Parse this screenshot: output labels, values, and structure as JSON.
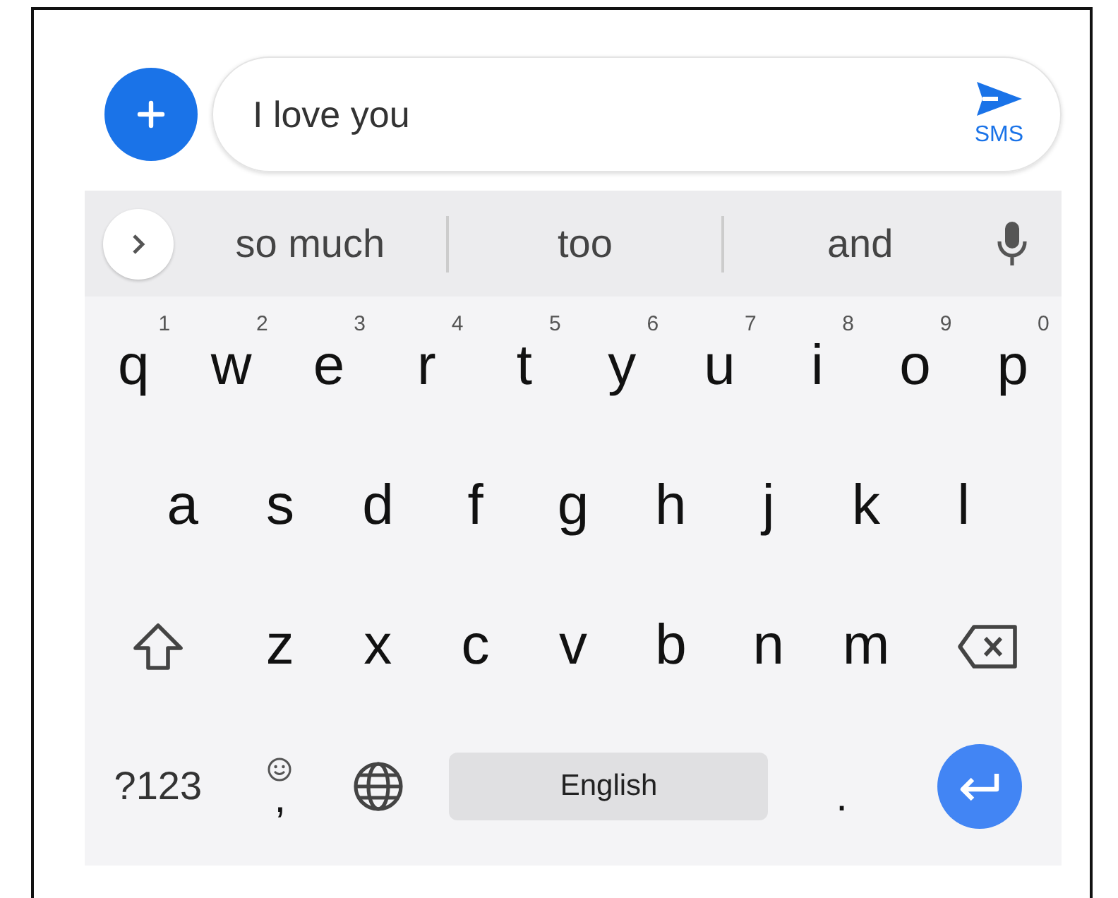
{
  "compose": {
    "value": "I love you",
    "send_label": "SMS"
  },
  "suggestions": [
    "so much",
    "too",
    "and"
  ],
  "keyboard": {
    "rows": [
      {
        "keys": [
          {
            "kind": "letter",
            "label": "q",
            "hint": "1"
          },
          {
            "kind": "letter",
            "label": "w",
            "hint": "2"
          },
          {
            "kind": "letter",
            "label": "e",
            "hint": "3"
          },
          {
            "kind": "letter",
            "label": "r",
            "hint": "4"
          },
          {
            "kind": "letter",
            "label": "t",
            "hint": "5"
          },
          {
            "kind": "letter",
            "label": "y",
            "hint": "6"
          },
          {
            "kind": "letter",
            "label": "u",
            "hint": "7"
          },
          {
            "kind": "letter",
            "label": "i",
            "hint": "8"
          },
          {
            "kind": "letter",
            "label": "o",
            "hint": "9"
          },
          {
            "kind": "letter",
            "label": "p",
            "hint": "0"
          }
        ]
      },
      {
        "keys": [
          {
            "kind": "letter",
            "label": "a"
          },
          {
            "kind": "letter",
            "label": "s"
          },
          {
            "kind": "letter",
            "label": "d"
          },
          {
            "kind": "letter",
            "label": "f"
          },
          {
            "kind": "letter",
            "label": "g"
          },
          {
            "kind": "letter",
            "label": "h"
          },
          {
            "kind": "letter",
            "label": "j"
          },
          {
            "kind": "letter",
            "label": "k"
          },
          {
            "kind": "letter",
            "label": "l"
          }
        ]
      },
      {
        "keys": [
          {
            "kind": "shift"
          },
          {
            "kind": "letter",
            "label": "z"
          },
          {
            "kind": "letter",
            "label": "x"
          },
          {
            "kind": "letter",
            "label": "c"
          },
          {
            "kind": "letter",
            "label": "v"
          },
          {
            "kind": "letter",
            "label": "b"
          },
          {
            "kind": "letter",
            "label": "n"
          },
          {
            "kind": "letter",
            "label": "m"
          },
          {
            "kind": "backspace"
          }
        ]
      },
      {
        "keys": [
          {
            "kind": "symbols",
            "label": "?123"
          },
          {
            "kind": "comma",
            "label": ","
          },
          {
            "kind": "globe"
          },
          {
            "kind": "space",
            "label": "English"
          },
          {
            "kind": "period",
            "label": "."
          },
          {
            "kind": "enter"
          }
        ]
      }
    ]
  }
}
